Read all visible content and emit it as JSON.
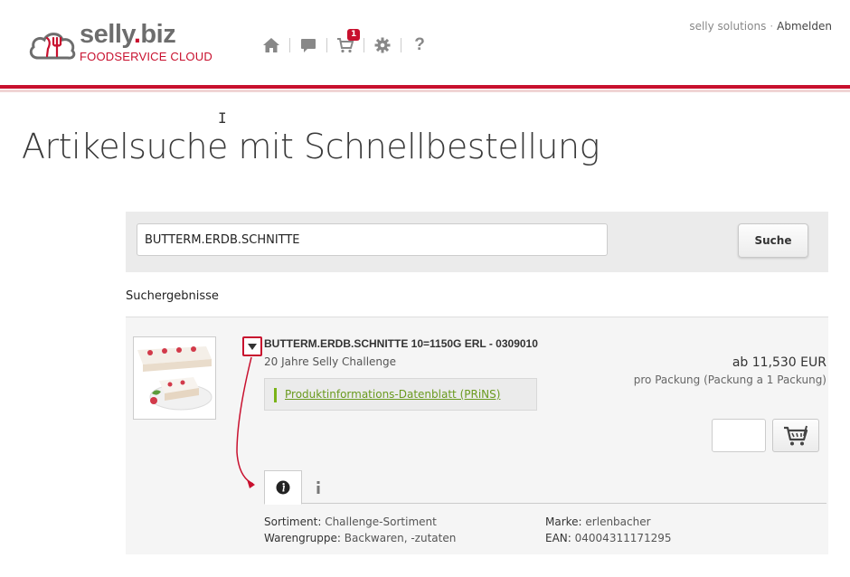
{
  "header": {
    "brand": "selly",
    "brand_dot": ".",
    "brand_tld": "biz",
    "tagline": "FOODSERVICE CLOUD",
    "cart_count": "1",
    "company": "selly solutions",
    "separator": "·",
    "logout": "Abmelden",
    "nav_icons": [
      "home-icon",
      "chat-icon",
      "cart-icon",
      "gear-icon",
      "help-icon"
    ],
    "help_glyph": "?"
  },
  "page": {
    "title": "Artikelsuche mit Schnellbestellung",
    "cursor_glyph": "I"
  },
  "search": {
    "value": "BUTTERM.ERDB.SCHNITTE",
    "button_label": "Suche"
  },
  "results": {
    "title": "Suchergebnisse",
    "items": [
      {
        "title": "BUTTERM.ERDB.SCHNITTE 10=1150G ERL - 0309010",
        "subtitle": "20 Jahre Selly Challenge",
        "prins_link": "Produktinformations-Datenblatt (PRiNS)",
        "price": "ab 11,530 EUR",
        "price_unit": "pro Packung (Packung a 1 Packung)",
        "quantity": "",
        "tabs": [
          "info-circle-icon",
          "info-icon"
        ],
        "details": {
          "sortiment_label": "Sortiment:",
          "sortiment_value": "Challenge-Sortiment",
          "warengruppe_label": "Warengruppe:",
          "warengruppe_value": "Backwaren, -zutaten",
          "marke_label": "Marke:",
          "marke_value": "erlenbacher",
          "ean_label": "EAN:",
          "ean_value": "04004311171295"
        }
      }
    ]
  },
  "colors": {
    "brand_red": "#c8102e",
    "brand_gray": "#6d6d6d",
    "link_green": "#6a9a1f"
  }
}
